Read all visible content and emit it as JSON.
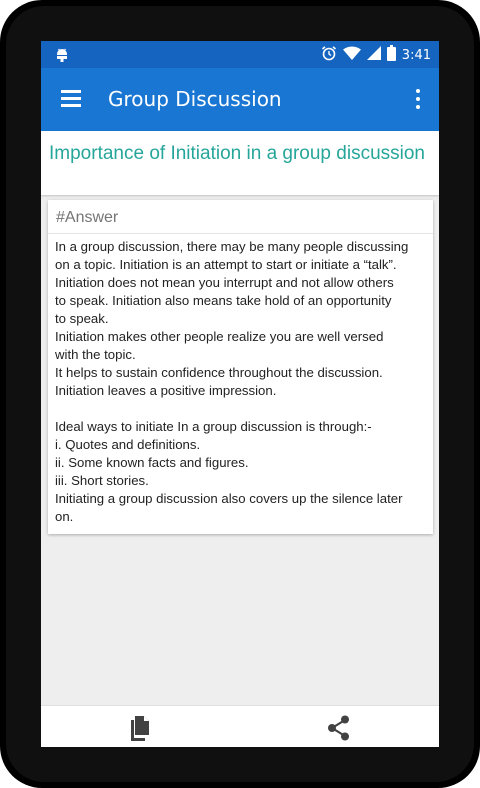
{
  "status_bar": {
    "time": "3:41"
  },
  "app_bar": {
    "title": "Group Discussion"
  },
  "question": {
    "text": "Importance of Initiation in a group discussion"
  },
  "answer_card": {
    "heading": "#Answer",
    "lines": [
      "In a group discussion, there may be many people discussing",
      "on a topic. Initiation is an attempt to start or initiate a “talk”.",
      "Initiation does not mean you interrupt and not allow others",
      "to speak. Initiation also means take hold of an opportunity",
      "to speak.",
      "Initiation makes other people realize you are well versed",
      "with the topic.",
      "It helps to sustain confidence throughout the discussion.",
      "Initiation leaves a positive impression.",
      "",
      "Ideal ways to initiate In a group discussion is through:-",
      "i. Quotes and definitions.",
      "ii. Some known facts and figures.",
      "iii. Short stories.",
      "Initiating a group discussion also covers up the silence later",
      "on."
    ]
  },
  "colors": {
    "status_bar": "#1565c0",
    "app_bar": "#1976d2",
    "question_text": "#26a69a",
    "icon_gray": "#424242"
  },
  "bottom_bar": {
    "icons": [
      "copy-icon",
      "share-icon"
    ]
  }
}
